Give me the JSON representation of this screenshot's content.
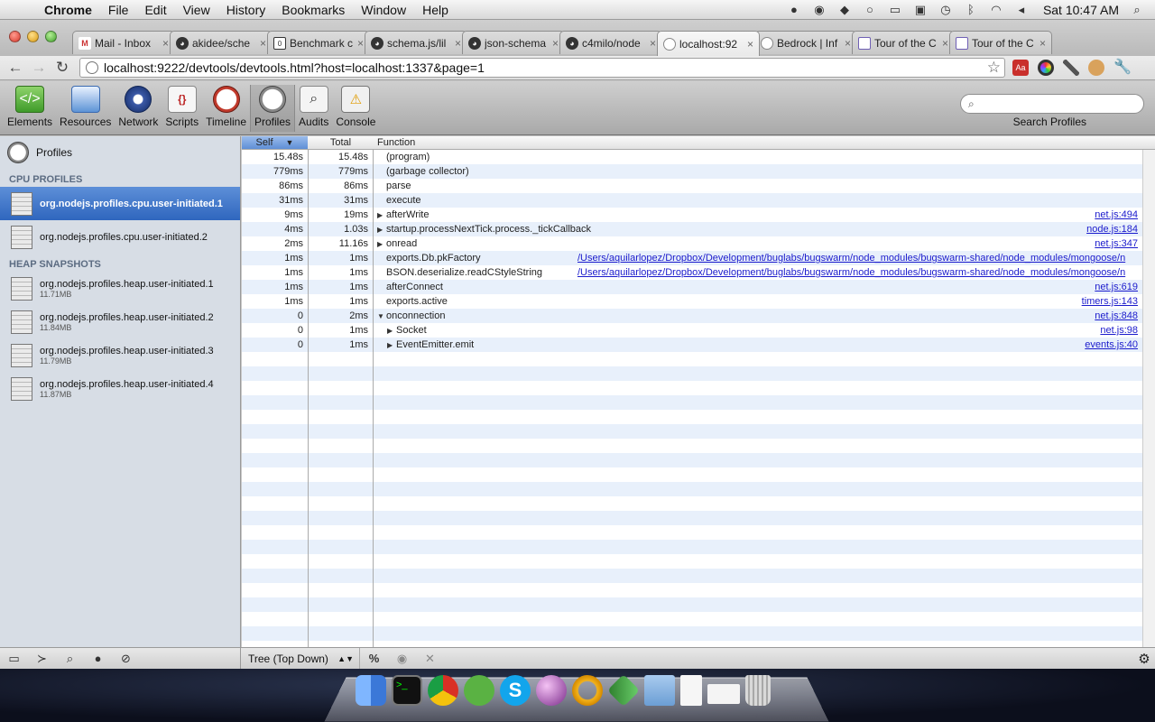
{
  "menubar": {
    "apple": "",
    "items": [
      "Chrome",
      "File",
      "Edit",
      "View",
      "History",
      "Bookmarks",
      "Window",
      "Help"
    ],
    "clock": "Sat 10:47 AM"
  },
  "tabs": [
    {
      "title": "Mail - Inbox",
      "icon": "mail-icon",
      "active": false
    },
    {
      "title": "akidee/sche",
      "icon": "github-icon",
      "active": false
    },
    {
      "title": "Benchmark c",
      "icon": "benchmark-icon",
      "active": false
    },
    {
      "title": "schema.js/lil",
      "icon": "github-icon",
      "active": false
    },
    {
      "title": "json-schema",
      "icon": "github-icon",
      "active": false
    },
    {
      "title": "c4milo/node",
      "icon": "github-icon",
      "active": false
    },
    {
      "title": "localhost:92",
      "icon": "globe-icon",
      "active": true
    },
    {
      "title": "Bedrock | Inf",
      "icon": "globe-icon",
      "active": false
    },
    {
      "title": "Tour of the C",
      "icon": "tour-icon",
      "active": false
    },
    {
      "title": "Tour of the C",
      "icon": "tour-icon",
      "active": false
    }
  ],
  "address_bar": {
    "url": "localhost:9222/devtools/devtools.html?host=localhost:1337&page=1"
  },
  "devtools": {
    "panels": [
      {
        "label": "Elements",
        "icon": "elements-icon",
        "active": false
      },
      {
        "label": "Resources",
        "icon": "resources-icon",
        "active": false
      },
      {
        "label": "Network",
        "icon": "network-icon",
        "active": false
      },
      {
        "label": "Scripts",
        "icon": "scripts-icon",
        "active": false
      },
      {
        "label": "Timeline",
        "icon": "timeline-icon",
        "active": false
      },
      {
        "label": "Profiles",
        "icon": "profiles-icon",
        "active": true
      },
      {
        "label": "Audits",
        "icon": "audits-icon",
        "active": false
      },
      {
        "label": "Console",
        "icon": "console-icon",
        "active": false
      }
    ],
    "search": {
      "label": "Search Profiles",
      "value": ""
    }
  },
  "sidebar": {
    "root_label": "Profiles",
    "cpu_section": "CPU PROFILES",
    "cpu_profiles": [
      {
        "title": "org.nodejs.profiles.cpu.user-initiated.1",
        "selected": true
      },
      {
        "title": "org.nodejs.profiles.cpu.user-initiated.2",
        "selected": false
      }
    ],
    "heap_section": "HEAP SNAPSHOTS",
    "heap_snapshots": [
      {
        "title": "org.nodejs.profiles.heap.user-initiated.1",
        "size": "11.71MB"
      },
      {
        "title": "org.nodejs.profiles.heap.user-initiated.2",
        "size": "11.84MB"
      },
      {
        "title": "org.nodejs.profiles.heap.user-initiated.3",
        "size": "11.79MB"
      },
      {
        "title": "org.nodejs.profiles.heap.user-initiated.4",
        "size": "11.87MB"
      }
    ]
  },
  "grid": {
    "columns": {
      "self": "Self",
      "total": "Total",
      "function": "Function"
    },
    "sort_indicator": "▼",
    "rows": [
      {
        "self": "15.48s",
        "total": "15.48s",
        "function": "(program)",
        "expander": "",
        "depth": 0,
        "url": ""
      },
      {
        "self": "779ms",
        "total": "779ms",
        "function": "(garbage collector)",
        "expander": "",
        "depth": 0,
        "url": ""
      },
      {
        "self": "86ms",
        "total": "86ms",
        "function": "parse",
        "expander": "",
        "depth": 0,
        "url": ""
      },
      {
        "self": "31ms",
        "total": "31ms",
        "function": "execute",
        "expander": "",
        "depth": 0,
        "url": ""
      },
      {
        "self": "9ms",
        "total": "19ms",
        "function": "afterWrite",
        "expander": "▶",
        "depth": 0,
        "url": "net.js:494"
      },
      {
        "self": "4ms",
        "total": "1.03s",
        "function": "startup.processNextTick.process._tickCallback",
        "expander": "▶",
        "depth": 0,
        "url": "node.js:184"
      },
      {
        "self": "2ms",
        "total": "11.16s",
        "function": "onread",
        "expander": "▶",
        "depth": 0,
        "url": "net.js:347"
      },
      {
        "self": "1ms",
        "total": "1ms",
        "function": "exports.Db.pkFactory",
        "expander": "",
        "depth": 0,
        "url": "/Users/aquilarlopez/Dropbox/Development/buglabs/bugswarm/node_modules/bugswarm-shared/node_modules/mongoose/n",
        "long": true
      },
      {
        "self": "1ms",
        "total": "1ms",
        "function": "BSON.deserialize.readCStyleString",
        "expander": "",
        "depth": 0,
        "url": "/Users/aquilarlopez/Dropbox/Development/buglabs/bugswarm/node_modules/bugswarm-shared/node_modules/mongoose/n",
        "long": true
      },
      {
        "self": "1ms",
        "total": "1ms",
        "function": "afterConnect",
        "expander": "",
        "depth": 0,
        "url": "net.js:619"
      },
      {
        "self": "1ms",
        "total": "1ms",
        "function": "exports.active",
        "expander": "",
        "depth": 0,
        "url": "timers.js:143"
      },
      {
        "self": "0",
        "total": "2ms",
        "function": "onconnection",
        "expander": "▼",
        "depth": 0,
        "url": "net.js:848"
      },
      {
        "self": "0",
        "total": "1ms",
        "function": "Socket",
        "expander": "▶",
        "depth": 1,
        "url": "net.js:98"
      },
      {
        "self": "0",
        "total": "1ms",
        "function": "EventEmitter.emit",
        "expander": "▶",
        "depth": 1,
        "url": "events.js:40"
      }
    ]
  },
  "statusbar": {
    "view_mode": "Tree (Top Down)",
    "percent_label": "%"
  }
}
